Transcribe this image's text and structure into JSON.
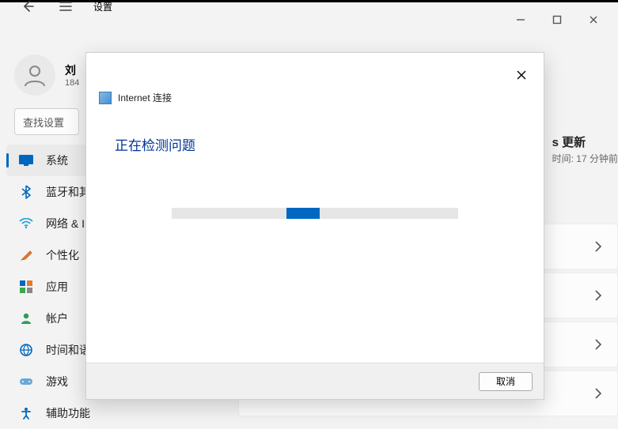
{
  "window": {
    "app_title": "设置"
  },
  "user": {
    "name": "刘",
    "sub": "184"
  },
  "search": {
    "placeholder": "查找设置"
  },
  "sidebar": {
    "items": [
      {
        "label": "系统"
      },
      {
        "label": "蓝牙和其"
      },
      {
        "label": "网络 & In"
      },
      {
        "label": "个性化"
      },
      {
        "label": "应用"
      },
      {
        "label": "帐户"
      },
      {
        "label": "时间和语"
      },
      {
        "label": "游戏"
      },
      {
        "label": "辅助功能"
      }
    ]
  },
  "main": {
    "update_peek_title": "s 更新",
    "update_peek_sub": "时间: 17 分钟前"
  },
  "dialog": {
    "title": "Internet 连接",
    "message": "正在检测问题",
    "cancel_label": "取消"
  }
}
